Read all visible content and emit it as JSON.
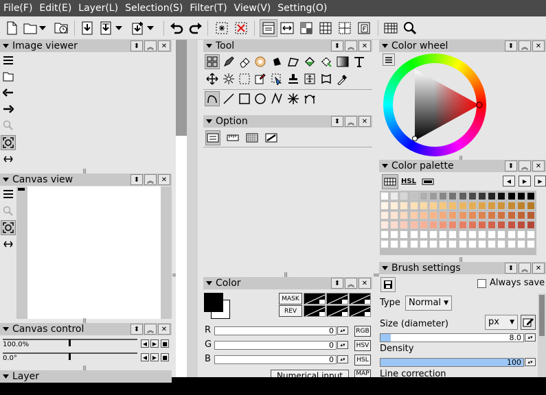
{
  "menu": [
    "File(F)",
    "Edit(E)",
    "Layer(L)",
    "Selection(S)",
    "Filter(T)",
    "View(V)",
    "Setting(O)"
  ],
  "panels": {
    "image_viewer": "Image viewer",
    "canvas_view": "Canvas view",
    "canvas_control": "Canvas control",
    "layer": "Layer",
    "tool": "Tool",
    "option": "Option",
    "color": "Color",
    "color_wheel": "Color wheel",
    "color_palette": "Color palette",
    "brush_settings": "Brush settings"
  },
  "canvas_control": {
    "zoom": "100.0%",
    "rotation": "0.0°"
  },
  "color_panel": {
    "mask": "MASK",
    "rev": "REV",
    "channels": [
      {
        "label": "R",
        "value": "0",
        "mode": "RGB"
      },
      {
        "label": "G",
        "value": "0",
        "mode": "HSV"
      },
      {
        "label": "B",
        "value": "0",
        "mode": "HSL"
      }
    ],
    "numerical_input": "Numerical input",
    "extra_mode": "MAP"
  },
  "palette": {
    "hsl_tab": "HSL",
    "rows": [
      [
        "#ffffff",
        "#ebebeb",
        "#d7d7d7",
        "#c3c3c3",
        "#afafaf",
        "#9b9b9b",
        "#878787",
        "#737373",
        "#5f5f5f",
        "#4b4b4b",
        "#373737",
        "#232323",
        "#0f0f0f",
        "#000000",
        "#000000",
        "#000000"
      ],
      [
        "#fff6ea",
        "#ffefd9",
        "#fde8c8",
        "#fce1b6",
        "#fbd9a3",
        "#f9d091",
        "#f5c67d",
        "#f1bd6d",
        "#ebb55f",
        "#e5ad53",
        "#dea548",
        "#d69c3f",
        "#ce9337",
        "#c68a31",
        "#be822b",
        "#b67a26"
      ],
      [
        "#ffefe2",
        "#fde4d0",
        "#fcd9be",
        "#fbcdab",
        "#f9c19a",
        "#f6b589",
        "#f2aa7b",
        "#eea06e",
        "#e99662",
        "#e48c58",
        "#de834f",
        "#d77a47",
        "#d07240",
        "#c86a3a",
        "#c06335",
        "#b85c31"
      ],
      [
        "#ffe9e0",
        "#fddbce",
        "#fbccbb",
        "#f9bea9",
        "#f7b098",
        "#f4a388",
        "#f09679",
        "#eb8a6d",
        "#e67f63",
        "#e0755a",
        "#da6b52",
        "#d3624b",
        "#cc5a45",
        "#c45340",
        "#bc4c3b",
        "#b44637"
      ],
      [
        "#ffffff",
        "#ffffff",
        "#ffffff",
        "#ffffff",
        "#ffffff",
        "#ffffff",
        "#ffffff",
        "#ffffff",
        "#ffffff",
        "#ffffff",
        "#ffffff",
        "#ffffff",
        "#ffffff",
        "#ffffff",
        "#ffffff",
        "#ffffff"
      ],
      [
        "#ffffff",
        "#ffffff",
        "#ffffff",
        "#ffffff",
        "#ffffff",
        "#ffffff",
        "#ffffff",
        "#ffffff",
        "#ffffff",
        "#ffffff",
        "#ffffff",
        "#ffffff",
        "#ffffff",
        "#ffffff",
        "#ffffff",
        "#ffffff"
      ]
    ]
  },
  "brush": {
    "always_save": "Always save",
    "type_label": "Type",
    "type_value": "Normal",
    "size_label": "Size (diameter)",
    "unit": "px",
    "size_value": "8.0",
    "density_label": "Density",
    "density_value": "100",
    "line_correction": "Line correction"
  },
  "colors": {
    "menubar": "#4a4a4a",
    "panel": "#e6e6e6",
    "header": "#c8c8c8",
    "slider_fill": "#9cc6f5"
  }
}
